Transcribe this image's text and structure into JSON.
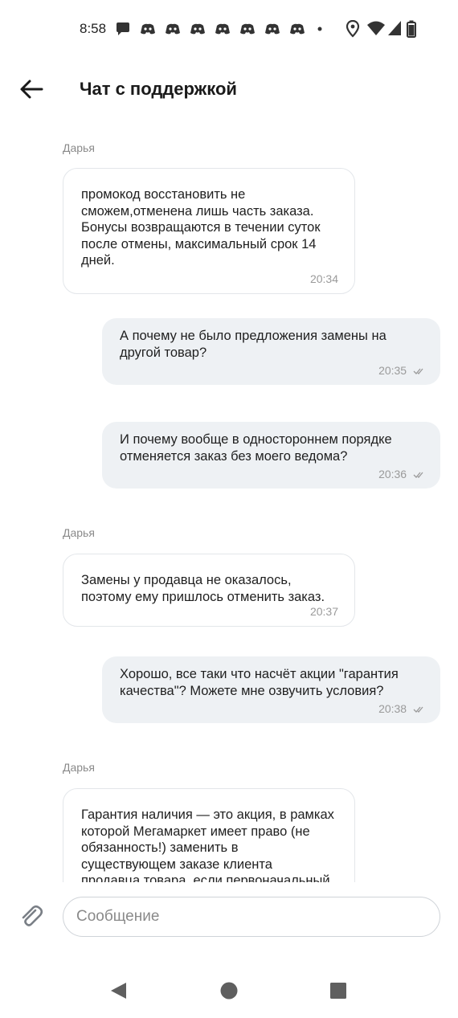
{
  "status_bar": {
    "time": "8:58",
    "notification_icons": [
      "chat-bubble-icon",
      "discord-icon",
      "discord-icon",
      "discord-icon",
      "discord-icon",
      "discord-icon",
      "discord-icon",
      "discord-icon"
    ],
    "right_icons": [
      "location-icon",
      "wifi-icon",
      "signal-icon",
      "battery-icon"
    ]
  },
  "header": {
    "title": "Чат с поддержкой"
  },
  "messages": [
    {
      "direction": "incoming",
      "sender": "Дарья",
      "text": "промокод восстановить не\nсможем,отменена лишь часть заказа.\nБонусы возвращаются в течении  суток\nпосле отмены, максимальный срок 14\nдней.",
      "time": "20:34"
    },
    {
      "direction": "outgoing",
      "text": "А почему не было предложения замены на\nдругой товар?",
      "time": "20:35",
      "status": "read"
    },
    {
      "direction": "outgoing",
      "text": "И почему вообще в одностороннем порядке\nотменяется заказ без моего ведома?",
      "time": "20:36",
      "status": "read"
    },
    {
      "direction": "incoming",
      "sender": "Дарья",
      "text": "Замены у продавца не оказалось,\nпоэтому ему пришлось отменить заказ.",
      "time": "20:37"
    },
    {
      "direction": "outgoing",
      "text": "Хорошо, все таки что насчёт акции \"гарантия\nкачества\"? Можете мне озвучить условия?",
      "time": "20:38",
      "status": "read"
    },
    {
      "direction": "incoming",
      "sender": "Дарья",
      "text": "Гарантия наличия — это акция, в рамках\nкоторой Мегамаркет имеет право (не\nобязанность!) заменить в\nсуществующем заказе клиента\nпродавца товара, если первоначальный"
    }
  ],
  "input": {
    "placeholder": "Сообщение"
  },
  "colors": {
    "outgoing_bubble": "#eef1f4",
    "incoming_border": "#e3e6ea",
    "meta_text": "#9a9a9a"
  }
}
